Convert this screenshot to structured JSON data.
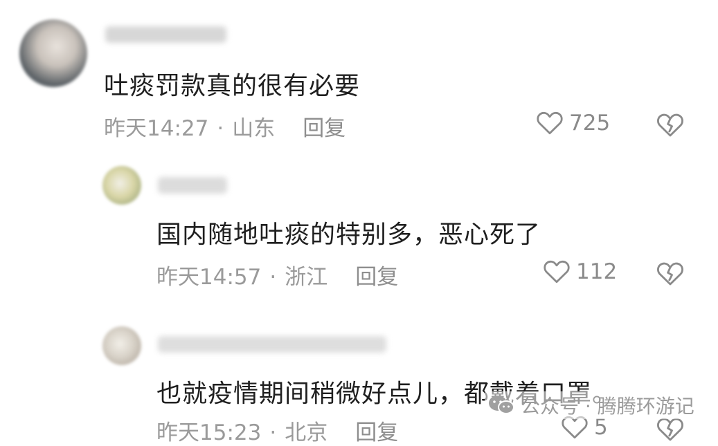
{
  "comments": [
    {
      "text": "吐痰罚款真的很有必要",
      "time": "昨天14:27",
      "separator": "·",
      "location": "山东",
      "reply_label": "回复",
      "likes": "725",
      "icons": {
        "like": "heart-outline-icon",
        "dislike": "broken-heart-icon"
      }
    },
    {
      "text": "国内随地吐痰的特别多，恶心死了",
      "time": "昨天14:57",
      "separator": "·",
      "location": "浙江",
      "reply_label": "回复",
      "likes": "112",
      "icons": {
        "like": "heart-outline-icon",
        "dislike": "broken-heart-icon"
      }
    },
    {
      "text": "也就疫情期间稍微好点儿，都戴着口罩。",
      "time": "昨天15:23",
      "separator": "·",
      "location": "北京",
      "reply_label": "回复",
      "likes": "5",
      "icons": {
        "like": "heart-outline-icon",
        "dislike": "broken-heart-icon"
      }
    }
  ],
  "watermark": {
    "text": "公众号 · 腾腾环游记",
    "icon": "wechat-icon"
  },
  "colors": {
    "text": "#1f1f1f",
    "meta": "#9a9a9a",
    "icon": "#8a8a8a"
  }
}
